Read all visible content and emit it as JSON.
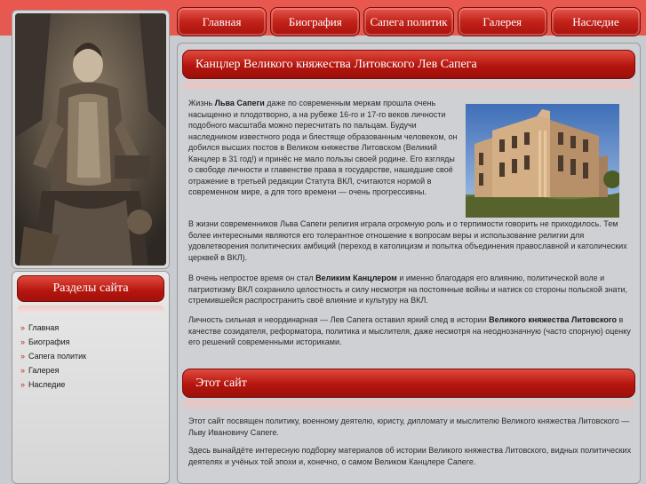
{
  "nav": {
    "items": [
      "Главная",
      "Биография",
      "Сапега политик",
      "Галерея",
      "Наследие"
    ]
  },
  "sidebar": {
    "title": "Разделы сайта",
    "items": [
      "Главная",
      "Биография",
      "Сапега политик",
      "Галерея",
      "Наследие"
    ]
  },
  "main": {
    "heading": "Канцлер Великого княжества Литовского Лев Сапега",
    "p1": {
      "pre": "Жизнь ",
      "bold": "Льва Сапеги",
      "post": " даже по современным меркам прошла очень насыщенно и плодотворно, а на рубеже 16-го и 17-го веков личности подобного масштаба можно пересчитать по пальцам. Будучи наследником известного рода и блестяще образованным человеком, он добился высших постов в Великом княжестве Литовском (Великий Канцлер в 31 год!) и принёс не мало пользы своей родине. Его взгляды о свободе личности и главенстве права в государстве, нашедшие своё отражение в третьей редакции Статута ВКЛ, считаются нормой в современном мире, а для того времени — очень прогрессивны."
    },
    "p2": "В жизни современников Льва Сапеги религия играла огромную роль и о терпимости говорить не приходилось. Тем более интересными являются его толерантное отношение к вопросам веры и использование религии для удовлетворения политических амбиций (переход в католицизм и попытка объединения православной и католических церквей в ВКЛ).",
    "p3": {
      "pre": "В очень непростое время он стал ",
      "bold": "Великим Канцлером",
      "post": " и именно благодаря его влиянию, политической воле и патриотизму ВКЛ сохранило целостность и силу несмотря на постоянные войны и натиск со стороны польской знати, стремившейся распространить своё влияние и культуру на ВКЛ."
    },
    "p4": {
      "pre": "Личность сильная и неординарная — Лев Сапега оставил яркий след в истории ",
      "bold": "Великого княжества Литовского",
      "post": " в качестве созидателя, реформатора, политика и мыслителя, даже несмотря на неоднозначную (часто спорную) оценку его решений современными историками."
    }
  },
  "about": {
    "heading": "Этот сайт",
    "p1": "Этот сайт посвящен политику, военному деятелю, юристу, дипломату и мыслителю Великого княжества Литовского — Льву Ивановичу Сапеге.",
    "p2": "Здесь вынайдёте интересную подборку материалов об истории Великого княжества Литовского, видных политических деятелях и учёных той эпохи и, конечно, о самом Великом Канцлере Сапеге."
  },
  "colors": {
    "accent": "#c8261d",
    "background": "#cfd0d3"
  }
}
